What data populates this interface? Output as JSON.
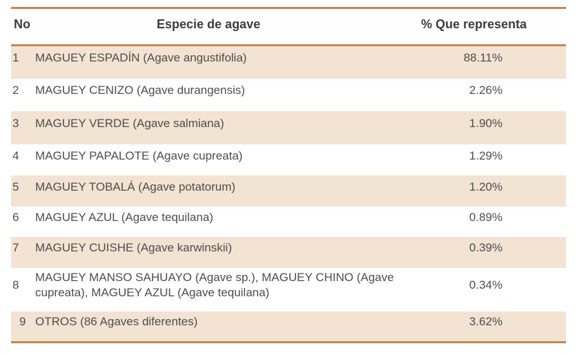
{
  "table": {
    "headers": {
      "no": "No",
      "species": "Especie de agave",
      "percent": "% Que representa"
    },
    "rows": [
      {
        "no": "1",
        "species": "MAGUEY ESPADÍN (Agave angustifolia)",
        "percent": "88.11%"
      },
      {
        "no": "2",
        "species": "MAGUEY CENIZO (Agave durangensis)",
        "percent": "2.26%"
      },
      {
        "no": "3",
        "species": "MAGUEY VERDE (Agave salmiana)",
        "percent": "1.90%"
      },
      {
        "no": "4",
        "species": "MAGUEY PAPALOTE (Agave cupreata)",
        "percent": "1.29%"
      },
      {
        "no": "5",
        "species": "MAGUEY TOBALÁ (Agave potatorum)",
        "percent": "1.20%"
      },
      {
        "no": "6",
        "species": "MAGUEY AZUL (Agave tequilana)",
        "percent": "0.89%"
      },
      {
        "no": "7",
        "species": "MAGUEY CUISHE (Agave karwinskii)",
        "percent": "0.39%"
      },
      {
        "no": "8",
        "species": "MAGUEY MANSO SAHUAYO (Agave sp.), MAGUEY CHINO (Agave cupreata), MAGUEY AZUL (Agave tequilana)",
        "percent": "0.34%"
      },
      {
        "no": "9",
        "species": "OTROS (86 Agaves diferentes)",
        "percent": "3.62%"
      }
    ]
  },
  "colors": {
    "rule": "#c08a4e",
    "shade": "#f3e3d3"
  }
}
